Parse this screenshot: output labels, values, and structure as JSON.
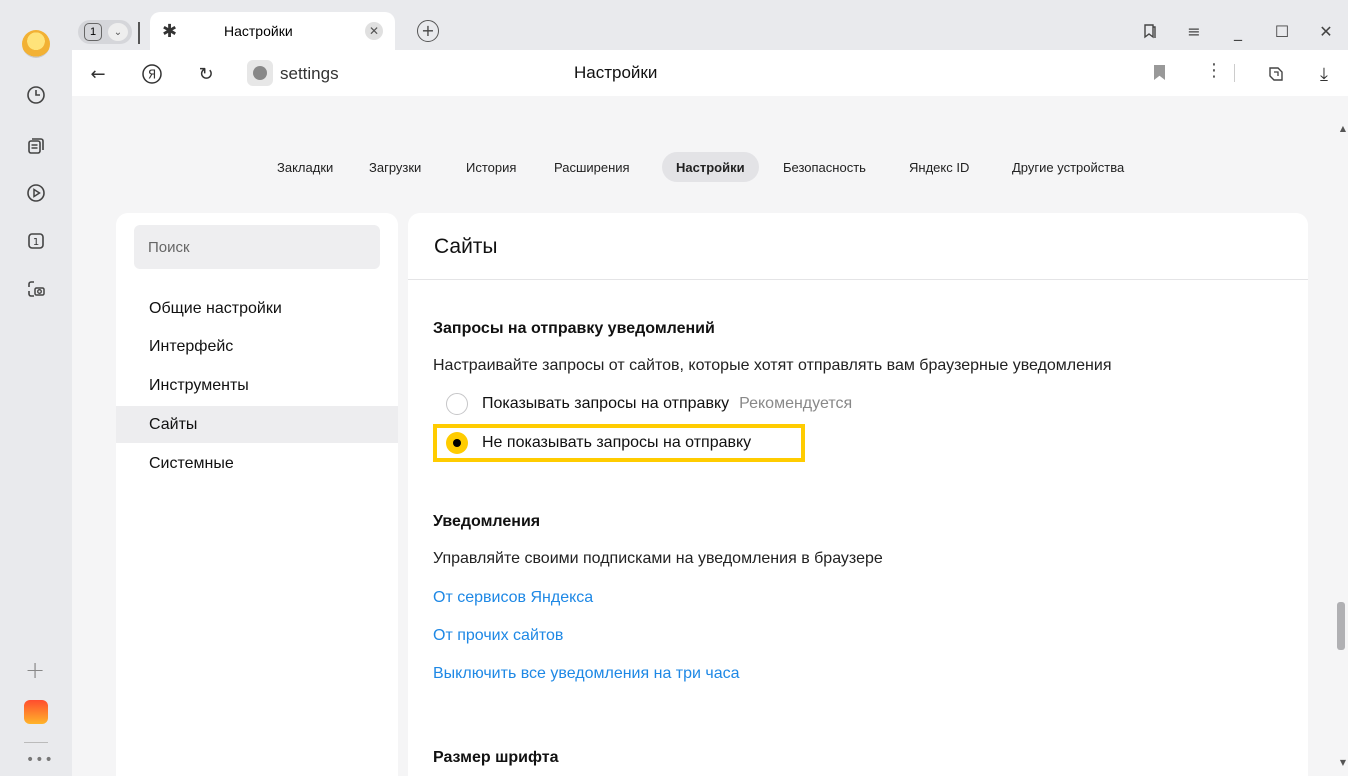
{
  "tabstrip": {
    "counter": "1",
    "tab_title": "Настройки"
  },
  "addressbar": {
    "url": "settings",
    "page_title": "Настройки"
  },
  "topnav": [
    {
      "label": "Закладки"
    },
    {
      "label": "Загрузки"
    },
    {
      "label": "История"
    },
    {
      "label": "Расширения"
    },
    {
      "label": "Настройки",
      "active": true
    },
    {
      "label": "Безопасность"
    },
    {
      "label": "Яндекс ID"
    },
    {
      "label": "Другие устройства"
    }
  ],
  "sidebar": {
    "search_placeholder": "Поиск",
    "items": [
      {
        "label": "Общие настройки"
      },
      {
        "label": "Интерфейс"
      },
      {
        "label": "Инструменты"
      },
      {
        "label": "Сайты",
        "active": true
      },
      {
        "label": "Системные"
      }
    ]
  },
  "main": {
    "title": "Сайты",
    "notif_requests": {
      "heading": "Запросы на отправку уведомлений",
      "description": "Настраивайте запросы от сайтов, которые хотят отправлять вам браузерные уведомления",
      "option_show": "Показывать запросы на отправку",
      "option_show_badge": "Рекомендуется",
      "option_hide": "Не показывать запросы на отправку",
      "selected": "option_hide"
    },
    "notifications": {
      "heading": "Уведомления",
      "description": "Управляйте своими подписками на уведомления в браузере",
      "links": [
        "От сервисов Яндекса",
        "От прочих сайтов",
        "Выключить все уведомления на три часа"
      ]
    },
    "font_size": {
      "heading": "Размер шрифта"
    }
  },
  "colors": {
    "accent": "#ffcc00",
    "link": "#1e88e5"
  },
  "sidepanel_icons": [
    "avatar",
    "history-icon",
    "collections-icon",
    "play-icon",
    "tab-count-icon",
    "screenshot-icon",
    "add-icon",
    "mail-icon",
    "more-icon"
  ]
}
